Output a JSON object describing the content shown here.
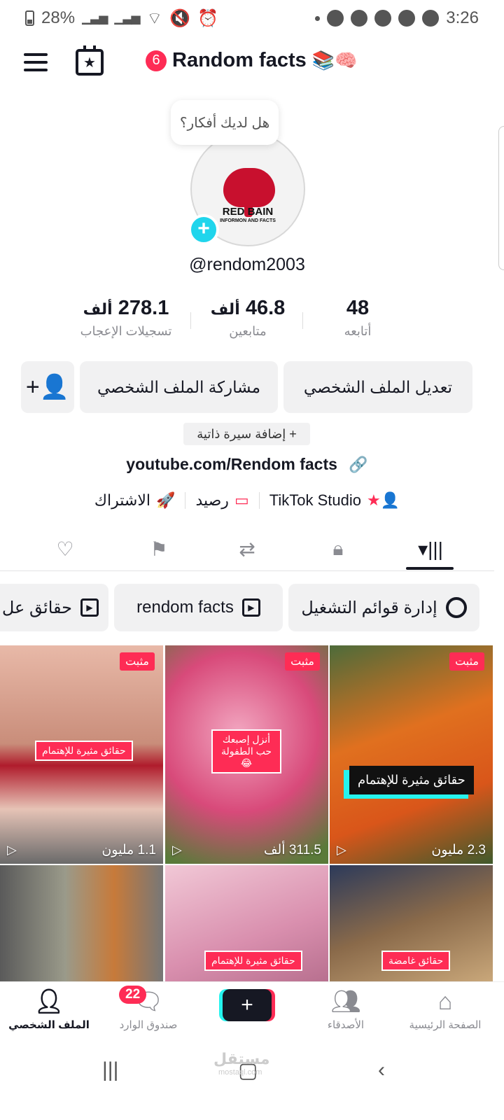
{
  "status_bar": {
    "battery": "28%",
    "time": "3:26"
  },
  "header": {
    "notification_count": "6",
    "title": "Random facts",
    "title_emoji": "📚🧠"
  },
  "profile": {
    "thoughts_prompt": "هل لديك أفكار؟",
    "avatar_logo_text": "RED BAIN",
    "avatar_logo_sub": "INFORMON AND FACTS",
    "username": "@rendom2003"
  },
  "stats": {
    "likes_value": "278.1",
    "likes_unit": "ألف",
    "likes_label": "تسجيلات الإعجاب",
    "followers_value": "46.8",
    "followers_unit": "ألف",
    "followers_label": "متابعين",
    "following_value": "48",
    "following_label": "أتابعه"
  },
  "actions": {
    "edit_profile": "تعديل الملف الشخصي",
    "share_profile": "مشاركة الملف الشخصي",
    "add_bio": "+ إضافة سيرة ذاتية"
  },
  "link": "youtube.com/Rendom facts",
  "tools": {
    "studio": "TikTok Studio",
    "balance": "رصيد",
    "subscription": "الاشتراك"
  },
  "playlists": {
    "manage": "إدارة قوائم التشغيل",
    "playlist_1": "rendom facts",
    "playlist_2": "حقائق عل"
  },
  "videos": [
    {
      "pinned": "مثبت",
      "overlay": "حقائق مثيرة للإهتمام",
      "views": "2.3 مليون"
    },
    {
      "pinned": "مثبت",
      "overlay": "أنزل إصبعك حب الطفولة 😂",
      "views": "311.5 ألف"
    },
    {
      "pinned": "مثبت",
      "overlay": "حقائق مثيرة للإهتمام",
      "views": "1.1 مليون"
    },
    {
      "overlay": "حقائق غامضة"
    },
    {
      "overlay": "حقائق مثيرة للإهتمام"
    },
    {
      "overlay": ""
    }
  ],
  "bottom_nav": {
    "home": "الصفحة الرئيسية",
    "friends": "الأصدقاء",
    "inbox": "صندوق الوارد",
    "inbox_badge": "22",
    "profile": "الملف الشخصي"
  },
  "watermark": "مستقل",
  "watermark_sub": "mostaql.com"
}
